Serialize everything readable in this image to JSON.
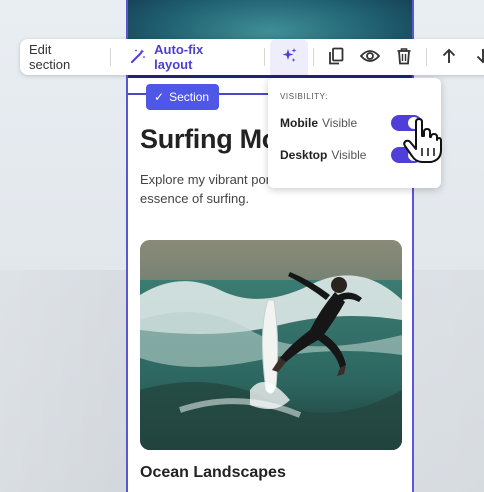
{
  "toolbar": {
    "edit_section": "Edit section",
    "autofix_label": "Auto-fix layout",
    "icons": [
      "magic-wand-icon",
      "sparkle-icon",
      "duplicate-icon",
      "eye-icon",
      "trash-icon",
      "arrow-up-icon",
      "arrow-down-icon"
    ]
  },
  "section_badge": "Section",
  "visibility_popover": {
    "title": "VISIBILITY:",
    "rows": [
      {
        "device": "Mobile",
        "state": "Visible",
        "on": true
      },
      {
        "device": "Desktop",
        "state": "Visible",
        "on": true
      }
    ]
  },
  "page": {
    "heading": "Surfing Mo",
    "body": "Explore my vibrant por… essence of surfing.",
    "body_line1": "Explore my vibrant por",
    "body_line2": "essence of surfing.",
    "subheading": "Ocean Landscapes"
  },
  "colors": {
    "accent": "#4f3fd8",
    "badge": "#4f58e6",
    "frame": "#5b57d4"
  }
}
